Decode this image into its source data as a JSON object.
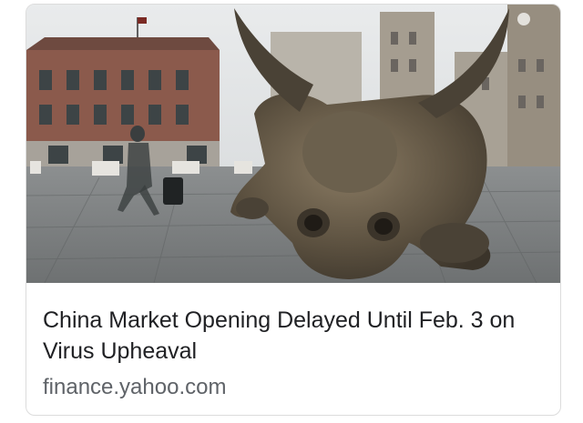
{
  "card": {
    "image_alt": "Charging bull sculpture on the Bund, Shanghai",
    "headline": "China Market Opening Delayed Until Feb. 3 on Virus Upheaval",
    "source": "finance.yahoo.com"
  }
}
